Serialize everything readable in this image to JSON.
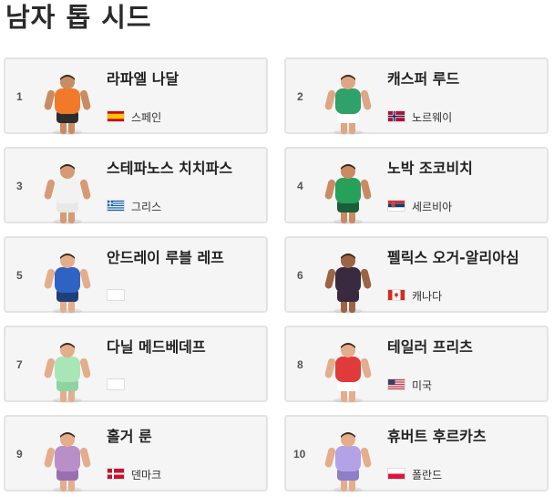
{
  "page": {
    "title": "남자 톱 시드"
  },
  "players": [
    {
      "seed": "1",
      "name": "라파엘 나달",
      "country": "스페인",
      "flag": "spain-flag",
      "shirt": "#f07a2a",
      "shorts": "#2d2d2d",
      "skin": "#c98b62"
    },
    {
      "seed": "2",
      "name": "캐스퍼 루드",
      "country": "노르웨이",
      "flag": "norway-flag",
      "shirt": "#2fa16a",
      "shorts": "#ffffff",
      "skin": "#e0a684"
    },
    {
      "seed": "3",
      "name": "스테파노스 치치파스",
      "country": "그리스",
      "flag": "greece-flag",
      "shirt": "#f2f2f2",
      "shorts": "#e8e8e8",
      "skin": "#d69a74"
    },
    {
      "seed": "4",
      "name": "노박 조코비치",
      "country": "세르비아",
      "flag": "serbia-flag",
      "shirt": "#27a05a",
      "shorts": "#1b5e37",
      "skin": "#c98b62"
    },
    {
      "seed": "5",
      "name": "안드레이 루블 레프",
      "country": "",
      "flag": "empty-flag",
      "shirt": "#2e63c4",
      "shorts": "#1f3e7a",
      "skin": "#e4ad8c"
    },
    {
      "seed": "6",
      "name": "펠릭스 오거-알리아심",
      "country": "캐나다",
      "flag": "canada-flag",
      "shirt": "#3a2a3f",
      "shorts": "#3a2a3f",
      "skin": "#9d6444"
    },
    {
      "seed": "7",
      "name": "다닐 메드베데프",
      "country": "",
      "flag": "empty-flag",
      "shirt": "#a8e6b8",
      "shorts": "#8fd3a5",
      "skin": "#e4ad8c"
    },
    {
      "seed": "8",
      "name": "테일러 프리츠",
      "country": "미국",
      "flag": "usa-flag",
      "shirt": "#e03a3a",
      "shorts": "#ffffff",
      "skin": "#e4ad8c"
    },
    {
      "seed": "9",
      "name": "홀거 룬",
      "country": "덴마크",
      "flag": "denmark-flag",
      "shirt": "#b88fc9",
      "shorts": "#9a6fb0",
      "skin": "#e4ad8c"
    },
    {
      "seed": "10",
      "name": "휴버트 후르카츠",
      "country": "폴란드",
      "flag": "poland-flag",
      "shirt": "#b3a3e6",
      "shorts": "#8c7fc7",
      "skin": "#e4ad8c"
    }
  ]
}
